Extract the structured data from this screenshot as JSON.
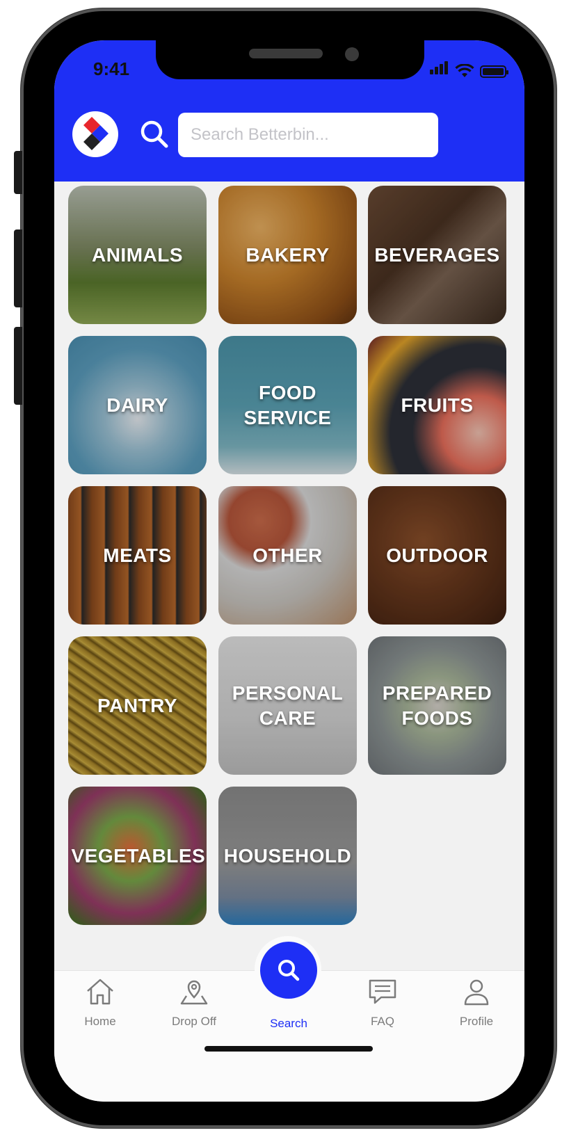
{
  "status_bar": {
    "time": "9:41"
  },
  "header": {
    "search_placeholder": "Search Betterbin...",
    "brand_colors": {
      "red": "#e8262c",
      "blue": "#1e2ff5",
      "black": "#222222"
    },
    "accent": "#1e2ff5"
  },
  "categories": [
    {
      "label": "ANIMALS"
    },
    {
      "label": "BAKERY"
    },
    {
      "label": "BEVERAGES"
    },
    {
      "label": "DAIRY"
    },
    {
      "label": "FOOD\nSERVICE"
    },
    {
      "label": "FRUITS"
    },
    {
      "label": "MEATS"
    },
    {
      "label": "OTHER"
    },
    {
      "label": "OUTDOOR"
    },
    {
      "label": "PANTRY"
    },
    {
      "label": "PERSONAL\nCARE"
    },
    {
      "label": "PREPARED\nFOODS"
    },
    {
      "label": "VEGETABLES"
    },
    {
      "label": "HOUSEHOLD"
    }
  ],
  "tabbar": {
    "tabs": [
      {
        "label": "Home",
        "icon": "home-icon"
      },
      {
        "label": "Drop Off",
        "icon": "map-pin-icon"
      },
      {
        "label": "Search",
        "icon": "search-icon",
        "active": true
      },
      {
        "label": "FAQ",
        "icon": "chat-icon"
      },
      {
        "label": "Profile",
        "icon": "user-icon"
      }
    ]
  }
}
